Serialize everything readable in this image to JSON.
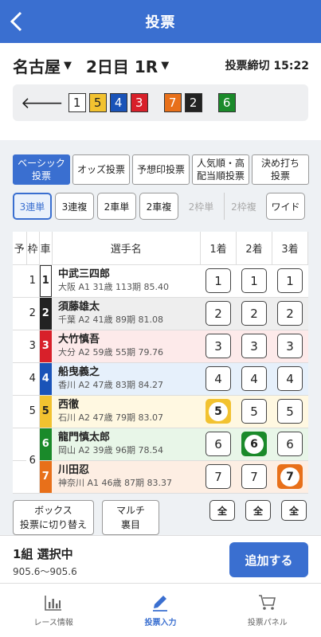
{
  "header": {
    "title": "投票"
  },
  "race": {
    "venue": "名古屋",
    "day_race": "2日目 1R",
    "deadline": "投票締切 15:22"
  },
  "selection_chips": [
    {
      "label": "1",
      "bg": "#ffffff",
      "fg": "#222222"
    },
    {
      "label": "5",
      "bg": "#f2c230",
      "fg": "#222222"
    },
    {
      "label": "4",
      "bg": "#1a53b8",
      "fg": "#ffffff"
    },
    {
      "label": "3",
      "bg": "#d8202a",
      "fg": "#ffffff"
    },
    {
      "label": "7",
      "bg": "#e8701a",
      "fg": "#ffffff"
    },
    {
      "label": "2",
      "bg": "#222222",
      "fg": "#ffffff"
    },
    {
      "label": "6",
      "bg": "#1a8a2a",
      "fg": "#ffffff"
    }
  ],
  "tabs": [
    {
      "label": "ベーシック\n投票",
      "active": true
    },
    {
      "label": "オッズ投票",
      "active": false
    },
    {
      "label": "予想印投票",
      "active": false
    },
    {
      "label": "人気順・高\n配当順投票",
      "active": false
    },
    {
      "label": "決め打ち\n投票",
      "active": false
    }
  ],
  "bet_types": [
    {
      "label": "3連単",
      "state": "active"
    },
    {
      "label": "3連複",
      "state": "normal"
    },
    {
      "label": "2車単",
      "state": "normal"
    },
    {
      "label": "2車複",
      "state": "normal"
    },
    {
      "label": "2枠単",
      "state": "disabled"
    },
    {
      "label": "2枠複",
      "state": "disabled"
    },
    {
      "label": "ワイド",
      "state": "normal"
    }
  ],
  "table_headers": {
    "yoso": "予",
    "waku": "枠",
    "car": "車",
    "name": "選手名",
    "pos1": "1着",
    "pos2": "2着",
    "pos3": "3着"
  },
  "riders": [
    {
      "waku": "1",
      "car": "1",
      "name": "中武三四郎",
      "info": "大阪 A1 31歳 113期 85.40",
      "row_bg": "#ffffff",
      "car_bg": "#ffffff",
      "car_fg": "#222222",
      "sel": [
        false,
        false,
        false
      ]
    },
    {
      "waku": "2",
      "car": "2",
      "name": "須藤雄太",
      "info": "千葉 A2 41歳 89期 81.08",
      "row_bg": "#eeeeee",
      "car_bg": "#222222",
      "car_fg": "#ffffff",
      "sel": [
        false,
        false,
        false
      ]
    },
    {
      "waku": "3",
      "car": "3",
      "name": "大竹慎吾",
      "info": "大分 A2 59歳 55期 79.76",
      "row_bg": "#fdeaea",
      "car_bg": "#d8202a",
      "car_fg": "#ffffff",
      "sel": [
        false,
        false,
        false
      ]
    },
    {
      "waku": "4",
      "car": "4",
      "name": "船曳義之",
      "info": "香川 A2 47歳 83期 84.27",
      "row_bg": "#e6f0fb",
      "car_bg": "#1a53b8",
      "car_fg": "#ffffff",
      "sel": [
        false,
        false,
        false
      ]
    },
    {
      "waku": "5",
      "car": "5",
      "name": "西徹",
      "info": "石川 A2 47歳 79期 83.07",
      "row_bg": "#fff8e1",
      "car_bg": "#f2c230",
      "car_fg": "#222222",
      "sel": [
        true,
        false,
        false
      ]
    },
    {
      "waku": "6",
      "car": "6",
      "name": "龍門慎太郎",
      "info": "岡山 A2 39歳 96期 78.54",
      "row_bg": "#e8f6e8",
      "car_bg": "#1a8a2a",
      "car_fg": "#ffffff",
      "sel": [
        false,
        true,
        false
      ]
    },
    {
      "waku": "",
      "car": "7",
      "name": "川田忍",
      "info": "神奈川 A1 46歳 87期 83.37",
      "row_bg": "#fdeee3",
      "car_bg": "#e8701a",
      "car_fg": "#ffffff",
      "sel": [
        false,
        false,
        true
      ]
    }
  ],
  "bottom": {
    "box_label": "ボックス\n投票に切り替え",
    "multi_label": "マルチ\n裏目",
    "all_label": "全"
  },
  "footer": {
    "selection": "1組 選択中",
    "odds": "905.6～905.6",
    "add_label": "追加する"
  },
  "nav": [
    {
      "label": "レース情報",
      "icon": "bar-chart-icon",
      "active": false
    },
    {
      "label": "投票入力",
      "icon": "pencil-icon",
      "active": true
    },
    {
      "label": "投票パネル",
      "icon": "cart-icon",
      "active": false
    }
  ]
}
